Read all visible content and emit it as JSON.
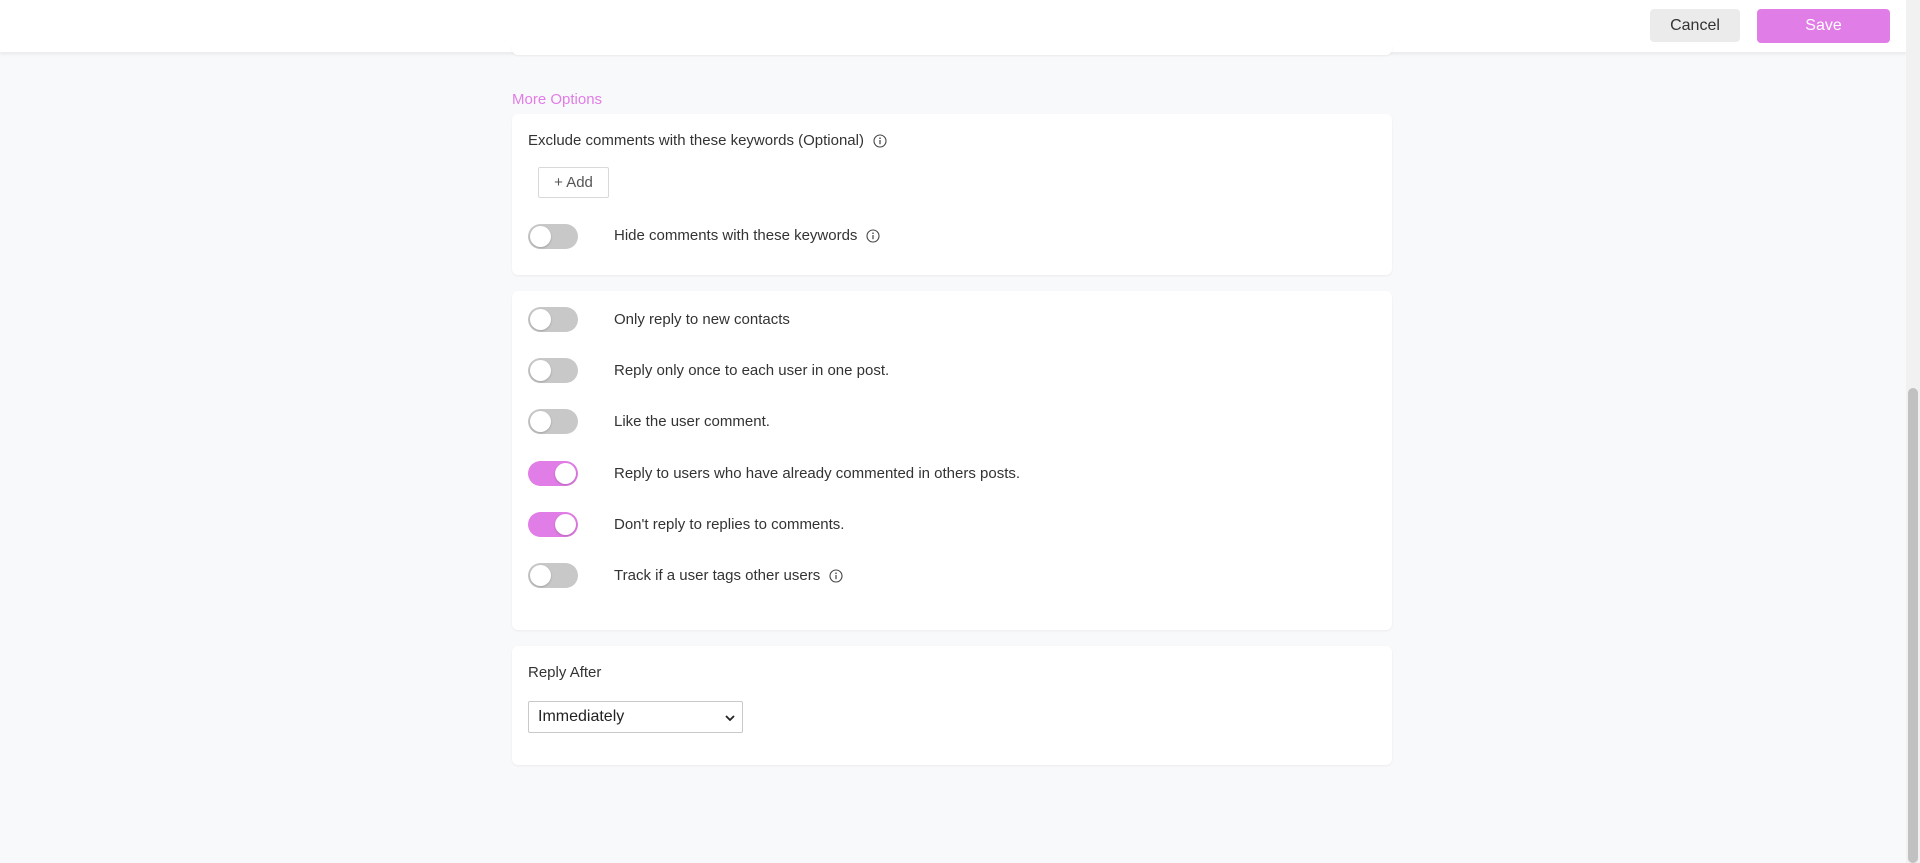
{
  "header": {
    "cancel_label": "Cancel",
    "save_label": "Save"
  },
  "more_options_label": "More Options",
  "keywords_card": {
    "title": "Exclude comments with these keywords (Optional)",
    "add_label": "+ Add",
    "hide_toggle": {
      "label": "Hide comments with these keywords",
      "on": false
    }
  },
  "options_card": {
    "toggles": [
      {
        "label": "Only reply to new contacts",
        "on": false,
        "info": false
      },
      {
        "label": "Reply only once to each user in one post.",
        "on": false,
        "info": false
      },
      {
        "label": "Like the user comment.",
        "on": false,
        "info": false
      },
      {
        "label": "Reply to users who have already commented in others posts.",
        "on": true,
        "info": false
      },
      {
        "label": "Don't reply to replies to comments.",
        "on": true,
        "info": false
      },
      {
        "label": "Track if a user tags other users",
        "on": false,
        "info": true
      }
    ]
  },
  "reply_after_card": {
    "title": "Reply After",
    "selected": "Immediately"
  },
  "colors": {
    "accent": "#e17de6",
    "toggle_off": "#c8c8c8",
    "background": "#f8f9fb"
  }
}
